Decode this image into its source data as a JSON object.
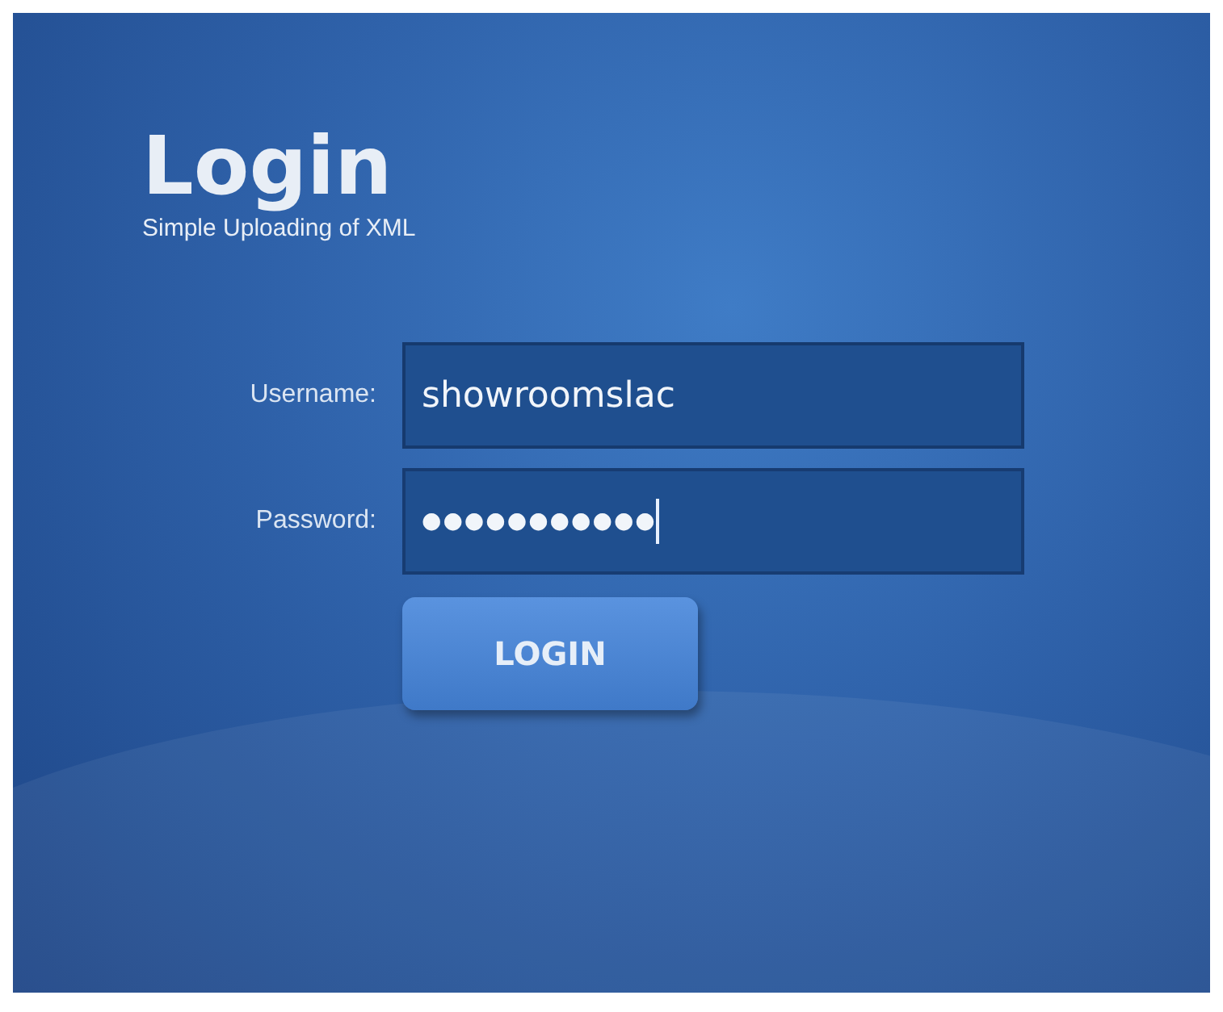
{
  "title": "Login",
  "subtitle": "Simple Uploading of XML",
  "fields": [
    {
      "kind": "text",
      "label": "Username:",
      "value": "showroomslac",
      "focused": false
    },
    {
      "kind": "password",
      "label": "Password:",
      "value": "●●●●●●●●●●●",
      "focused": true
    }
  ],
  "button": "LOGIN"
}
